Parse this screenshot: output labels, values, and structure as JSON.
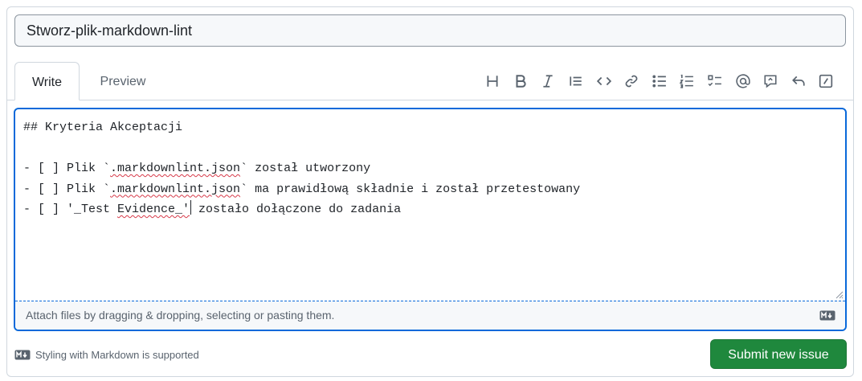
{
  "title_field": {
    "value": "Stworz-plik-markdown-lint"
  },
  "tabs": {
    "write": "Write",
    "preview": "Preview"
  },
  "toolbar": {
    "items": [
      "heading-icon",
      "bold-icon",
      "italic-icon",
      "quote-icon",
      "code-icon",
      "link-icon",
      "bulleted-list-icon",
      "numbered-list-icon",
      "task-list-icon",
      "mention-icon",
      "reference-icon",
      "undo-icon",
      "slash-commands-icon"
    ]
  },
  "editor": {
    "line1": "## Kryteria Akceptacji",
    "line3_prefix": "- [ ] Plik `",
    "line3_word": ".markdownlint.json",
    "line3_suffix": "` został utworzony",
    "line4_prefix": "- [ ] Plik `",
    "line4_word": ".markdownlint.json",
    "line4_suffix": "` ma prawidłową składnie i został przetestowany",
    "line5_prefix": "- [ ] '_Test ",
    "line5_word": "Evidence_'",
    "line5_suffix": " zostało dołączone do zadania"
  },
  "attach": {
    "label": "Attach files by dragging & dropping, selecting or pasting them."
  },
  "footer": {
    "markdown_note": "Styling with Markdown is supported"
  },
  "actions": {
    "submit": "Submit new issue"
  },
  "colors": {
    "accent": "#0969da",
    "submit": "#1f883d",
    "spellcheck": "#d73a49"
  }
}
